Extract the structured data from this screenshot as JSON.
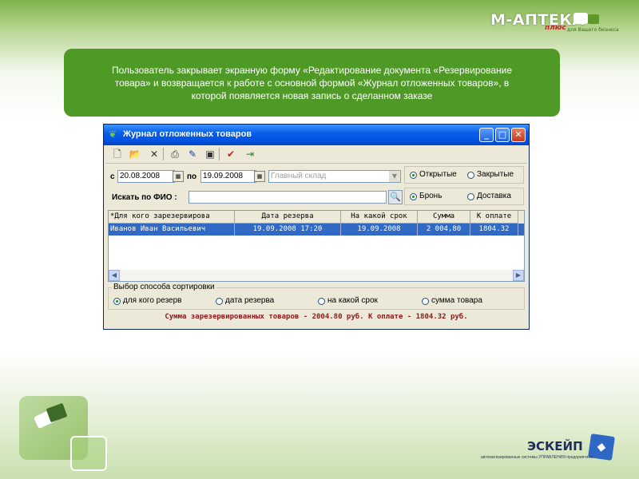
{
  "logo": {
    "brand": "М-АПТЕКА",
    "plus": "плюс",
    "tagline": "для Вашего бизнеса"
  },
  "banner": {
    "text": "Пользователь закрывает экранную форму «Редактирование документа «Резервирование товара» и возвращается к работе с основной формой «Журнал отложенных товаров», в которой появляется новая запись о сделанном заказе"
  },
  "window": {
    "title": "Журнал отложенных товаров",
    "filters": {
      "from_label": "с",
      "from_date": "20.08.2008",
      "to_label": "по",
      "to_date": "19.09.2008",
      "warehouse_placeholder": "Главный склад",
      "state_options": [
        "Открытые",
        "Закрытые"
      ],
      "search_label": "Искать по ФИО :",
      "search_value": "",
      "type_options": [
        "Бронь",
        "Доставка"
      ]
    },
    "grid": {
      "columns": [
        "*Для кого зарезервирова",
        "Дата резерва",
        "На какой срок",
        "Сумма",
        "К оплате"
      ],
      "rows": [
        [
          "Иванов Иван Васильевич",
          "19.09.2008 17:20",
          "19.09.2008",
          "2 004,80",
          "1804.32"
        ]
      ]
    },
    "sort": {
      "legend": "Выбор способа сортировки",
      "options": [
        "для кого резерв",
        "дата резерва",
        "на какой срок",
        "сумма  товара"
      ]
    },
    "status": "Сумма зарезервированных товаров - 2004.80 руб. К оплате - 1804.32 руб."
  },
  "footer_logo": {
    "name": "ЭСКЕЙП",
    "subtitle": "автоматизированные системы УПРАВЛЕНИЯ предприятием"
  }
}
